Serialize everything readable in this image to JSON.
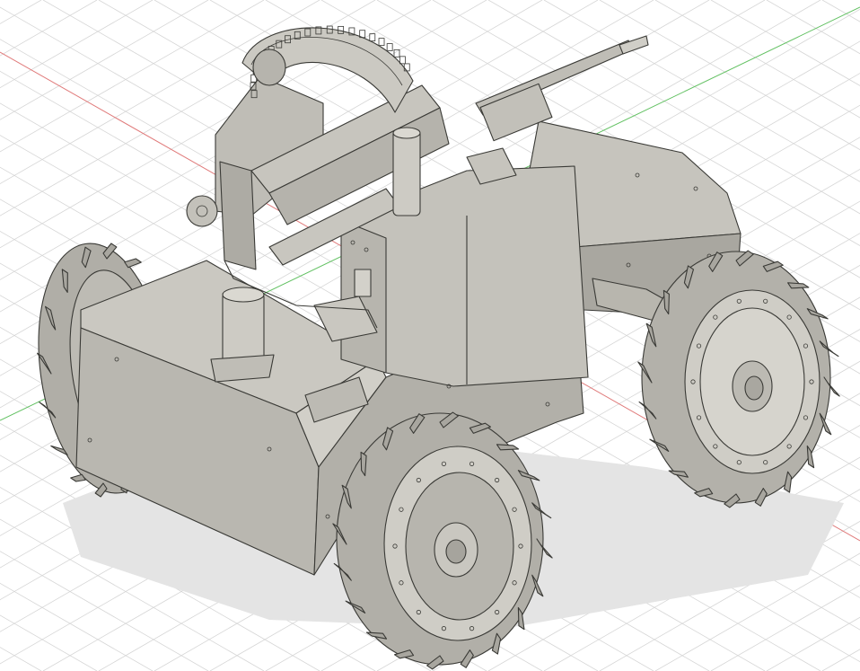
{
  "viewport": {
    "background": "#ffffff",
    "grid_color": "#d6d6d6",
    "x_axis_color": "#e07a7a",
    "y_axis_color": "#62c162",
    "model_body_color": "#c9c7c0",
    "model_shadow_color": "#e4e4e4",
    "edge_color": "#3a3a36"
  },
  "model": {
    "parts": [
      {
        "name": "rear-left-wheel",
        "icon": "tire"
      },
      {
        "name": "front-left-wheel",
        "icon": "tire"
      },
      {
        "name": "rear-right-wheel",
        "icon": "tire"
      },
      {
        "name": "front-right-wheel",
        "icon": "tire"
      },
      {
        "name": "chassis-body",
        "icon": "box"
      },
      {
        "name": "rear-plate",
        "icon": "plate"
      },
      {
        "name": "turret-frame",
        "icon": "frame"
      },
      {
        "name": "elevation-gear",
        "icon": "gear"
      },
      {
        "name": "gun-barrel",
        "icon": "barrel"
      },
      {
        "name": "camera-mount",
        "icon": "camera"
      },
      {
        "name": "sensor-canister",
        "icon": "cylinder"
      }
    ]
  }
}
